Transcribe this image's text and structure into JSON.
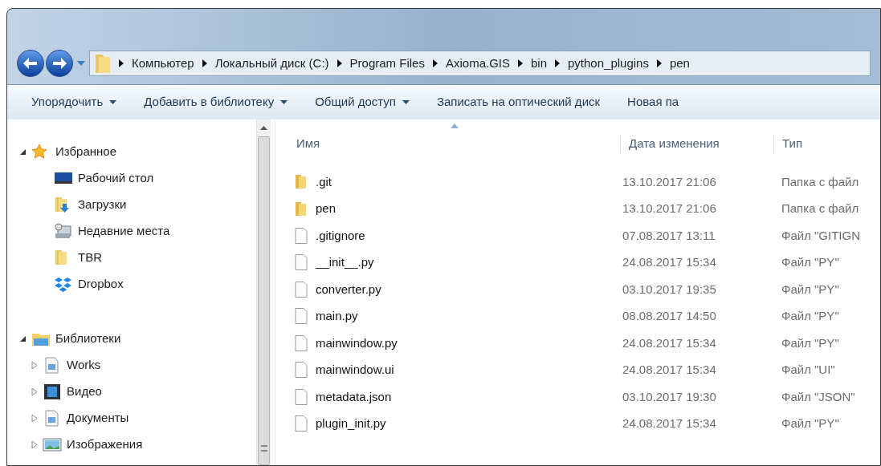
{
  "breadcrumb": [
    "Компьютер",
    "Локальный диск (C:)",
    "Program Files",
    "Axioma.GIS",
    "bin",
    "python_plugins",
    "pen"
  ],
  "toolbar": [
    {
      "label": "Упорядочить",
      "dropdown": true
    },
    {
      "label": "Добавить в библиотеку",
      "dropdown": true
    },
    {
      "label": "Общий доступ",
      "dropdown": true
    },
    {
      "label": "Записать на оптический диск",
      "dropdown": false
    },
    {
      "label": "Новая па",
      "dropdown": false
    }
  ],
  "sidebar": {
    "items": [
      {
        "kind": "group",
        "label": "Избранное",
        "expanded": true,
        "children": [
          {
            "kind": "item",
            "label": "Рабочий стол"
          },
          {
            "kind": "item",
            "label": "Загрузки"
          },
          {
            "kind": "item",
            "label": "Недавние места"
          },
          {
            "kind": "item",
            "label": "TBR"
          },
          {
            "kind": "item",
            "label": "Dropbox"
          }
        ]
      },
      {
        "kind": "group",
        "label": "Библиотеки",
        "expanded": true,
        "children": [
          {
            "kind": "node",
            "label": "Works",
            "expanded": false
          },
          {
            "kind": "node",
            "label": "Видео",
            "expanded": false
          },
          {
            "kind": "node",
            "label": "Документы",
            "expanded": false
          },
          {
            "kind": "node",
            "label": "Изображения",
            "expanded": false
          }
        ]
      }
    ]
  },
  "table": {
    "columns": [
      "Имя",
      "Дата изменения",
      "Тип"
    ],
    "rows": [
      {
        "kind": "folder",
        "name": ".git",
        "date": "13.10.2017 21:06",
        "type": "Папка с файл"
      },
      {
        "kind": "folder",
        "name": "pen",
        "date": "13.10.2017 21:06",
        "type": "Папка с файл"
      },
      {
        "kind": "file",
        "name": ".gitignore",
        "date": "07.08.2017 13:11",
        "type": "Файл \"GITIGN"
      },
      {
        "kind": "file",
        "name": "__init__.py",
        "date": "24.08.2017 15:34",
        "type": "Файл \"PY\""
      },
      {
        "kind": "file",
        "name": "converter.py",
        "date": "03.10.2017 19:35",
        "type": "Файл \"PY\""
      },
      {
        "kind": "file",
        "name": "main.py",
        "date": "08.08.2017 14:50",
        "type": "Файл \"PY\""
      },
      {
        "kind": "file",
        "name": "mainwindow.py",
        "date": "24.08.2017 15:34",
        "type": "Файл \"PY\""
      },
      {
        "kind": "file",
        "name": "mainwindow.ui",
        "date": "24.08.2017 15:34",
        "type": "Файл \"UI\""
      },
      {
        "kind": "file",
        "name": "metadata.json",
        "date": "03.10.2017 19:30",
        "type": "Файл \"JSON\""
      },
      {
        "kind": "file",
        "name": "plugin_init.py",
        "date": "24.08.2017 15:34",
        "type": "Файл \"PY\""
      }
    ]
  }
}
